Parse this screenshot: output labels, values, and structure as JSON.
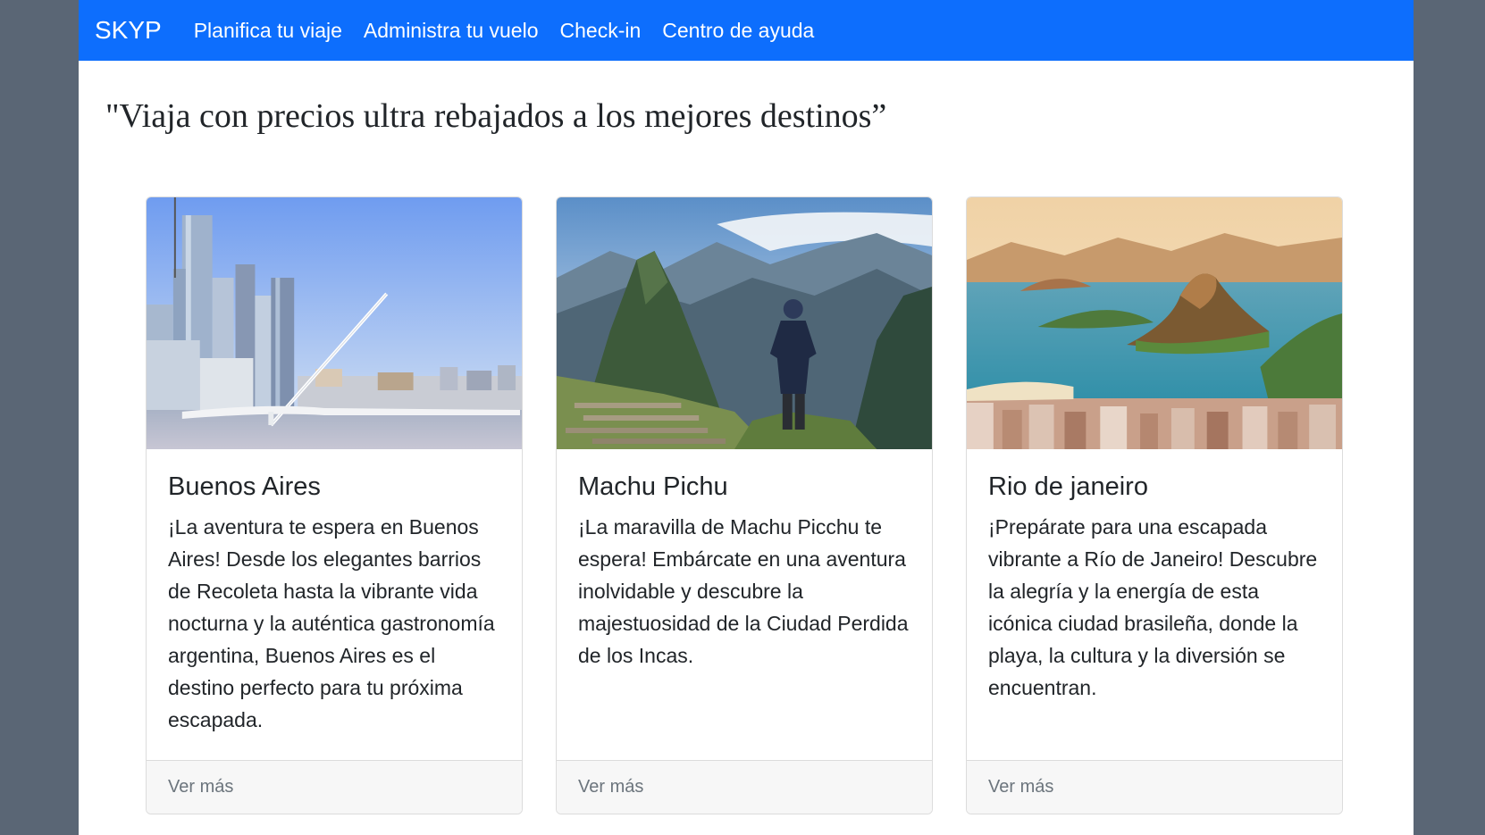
{
  "navbar": {
    "brand": "SKYP",
    "links": [
      "Planifica tu viaje",
      "Administra tu vuelo",
      "Check-in",
      "Centro de ayuda"
    ],
    "background": "#0d6efd"
  },
  "headline": "\"Viaja con precios ultra rebajados a los mejores destinos”",
  "cards": [
    {
      "title": "Buenos Aires",
      "text": "¡La aventura te espera en Buenos Aires! Desde los elegantes barrios de Recoleta hasta la vibrante vida nocturna y la auténtica gastronomía argentina, Buenos Aires es el destino perfecto para tu próxima escapada.",
      "link": "Ver más",
      "image": "buenos-aires-skyline-bridge"
    },
    {
      "title": "Machu Pichu",
      "text": "¡La maravilla de Machu Picchu te espera! Embárcate en una aventura inolvidable y descubre la majestuosidad de la Ciudad Perdida de los Incas.",
      "link": "Ver más",
      "image": "machu-picchu-mountains-hiker"
    },
    {
      "title": "Rio de janeiro",
      "text": "¡Prepárate para una escapada vibrante a Río de Janeiro! Descubre la alegría y la energía de esta icónica ciudad brasileña, donde la playa, la cultura y la diversión se encuentran.",
      "link": "Ver más",
      "image": "rio-de-janeiro-bay-sunset"
    }
  ]
}
